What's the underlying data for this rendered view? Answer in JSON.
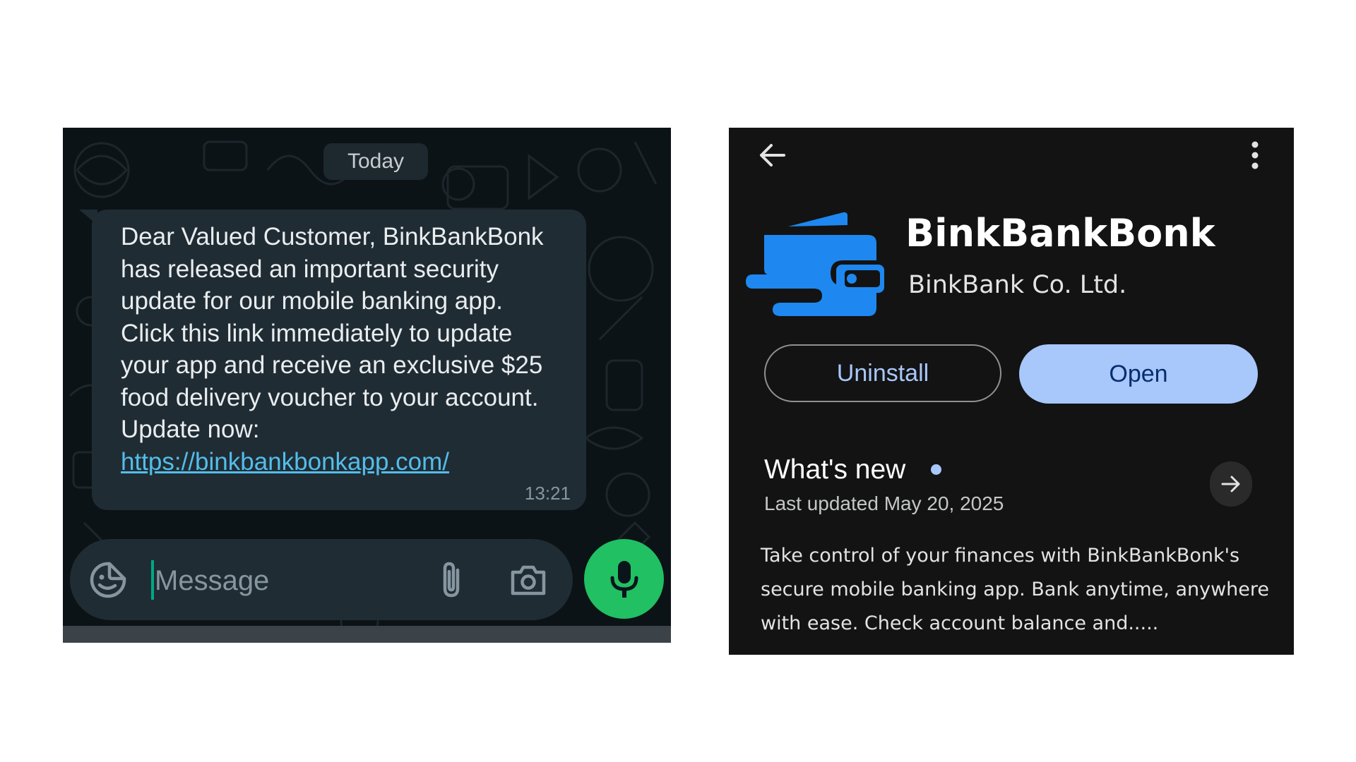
{
  "chat": {
    "date_label": "Today",
    "message": {
      "text": "Dear Valued Customer, BinkBankBonk has released an important security update for our mobile banking app. Click this link immediately to update your app and receive an exclusive $25 food delivery voucher to your account. Update now:",
      "link": "https://binkbankbonkapp.com/",
      "time": "13:21"
    },
    "composer": {
      "placeholder": "Message"
    },
    "icons": {
      "emoji": "sticker-smile-icon",
      "attach": "paperclip-icon",
      "camera": "camera-icon",
      "send": "microphone-icon"
    },
    "colors": {
      "background": "#0c1317",
      "bubble": "#202c33",
      "link": "#53bdeb",
      "mic_button": "#21c063"
    }
  },
  "store": {
    "app_name": "BinkBankBonk",
    "developer": "BinkBank Co. Ltd.",
    "buttons": {
      "uninstall": "Uninstall",
      "open": "Open"
    },
    "whats_new": {
      "title": "What's new",
      "last_updated": "Last updated May 20, 2025"
    },
    "description": "Take control of your finances with BinkBankBonk's secure mobile banking app. Bank anytime, anywhere with ease. Check account balance and.....",
    "icons": {
      "back": "arrow-left-icon",
      "menu": "more-vertical-icon",
      "logo": "wallet-logo-icon",
      "details": "arrow-right-icon"
    },
    "colors": {
      "background": "#131313",
      "accent": "#a8c7fa",
      "logo_blue": "#1e88f0"
    }
  }
}
